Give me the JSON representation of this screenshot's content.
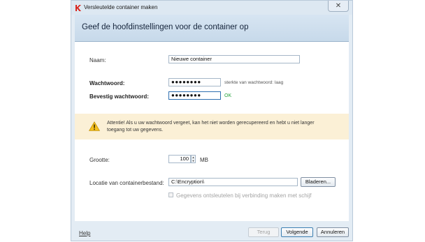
{
  "window": {
    "title": "Versleutelde container maken",
    "close_glyph": "✕"
  },
  "header": {
    "title": "Geef de hoofdinstellingen voor de container op"
  },
  "form": {
    "name_label": "Naam:",
    "name_value": "Nieuwe container",
    "password_label": "Wachtwoord:",
    "password_value": "●●●●●●●●",
    "strength_text": "sterkte van wachtwoord: laag",
    "confirm_label": "Bevestig wachtwoord:",
    "confirm_value": "●●●●●●●●",
    "confirm_status": "OK",
    "size_label": "Grootte:",
    "size_value": "100",
    "size_unit": "MB",
    "location_label": "Locatie van containerbestand:",
    "location_value": "C:\\Encryption\\",
    "browse_label": "Bladeren...",
    "disconnect_checkbox_label": "Gegevens ontsleutelen bij verbinding maken met schijf"
  },
  "warning": {
    "text": "Attentie! Als u uw wachtwoord vergeet, kan het niet worden gerecupereerd en hebt u niet langer toegang tot uw gegevens.",
    "icon": "warning-triangle-icon",
    "color": "#fbf0d6"
  },
  "footer": {
    "help_label": "Help",
    "back_label": "Terug",
    "next_label": "Volgende",
    "cancel_label": "Annuleren"
  },
  "colors": {
    "accent": "#2e6fb0",
    "ok": "#23a23a",
    "header_band": "#c7d9ea",
    "logo": "#d9251d"
  }
}
